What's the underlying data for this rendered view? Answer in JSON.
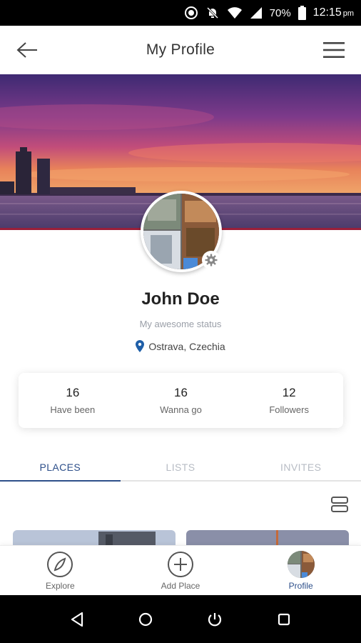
{
  "status_bar": {
    "battery": "70%",
    "time": "12:15",
    "ampm": "pm",
    "icons": [
      "circle-alert-icon",
      "mute-icon",
      "wifi-icon",
      "signal-icon",
      "battery-icon"
    ]
  },
  "header": {
    "title": "My Profile",
    "back_icon": "back-arrow-icon",
    "menu_icon": "hamburger-menu-icon"
  },
  "profile": {
    "name": "John Doe",
    "status": "My awesome status",
    "location": "Ostrava, Czechia",
    "settings_icon": "gear-icon"
  },
  "stats": [
    {
      "value": "16",
      "label": "Have been"
    },
    {
      "value": "16",
      "label": "Wanna go"
    },
    {
      "value": "12",
      "label": "Followers"
    }
  ],
  "tabs": [
    {
      "label": "PLACES",
      "active": true
    },
    {
      "label": "LISTS",
      "active": false
    },
    {
      "label": "INVITES",
      "active": false
    }
  ],
  "bottom_nav": [
    {
      "label": "Explore",
      "icon": "compass-icon",
      "active": false
    },
    {
      "label": "Add Place",
      "icon": "add-circle-icon",
      "active": false
    },
    {
      "label": "Profile",
      "icon": "avatar-icon",
      "active": true
    }
  ],
  "colors": {
    "accent": "#2d4f8a",
    "tab_inactive": "#b7bcc4",
    "status_gray": "#9a9fa8",
    "location_pin": "#1f5fa8"
  }
}
